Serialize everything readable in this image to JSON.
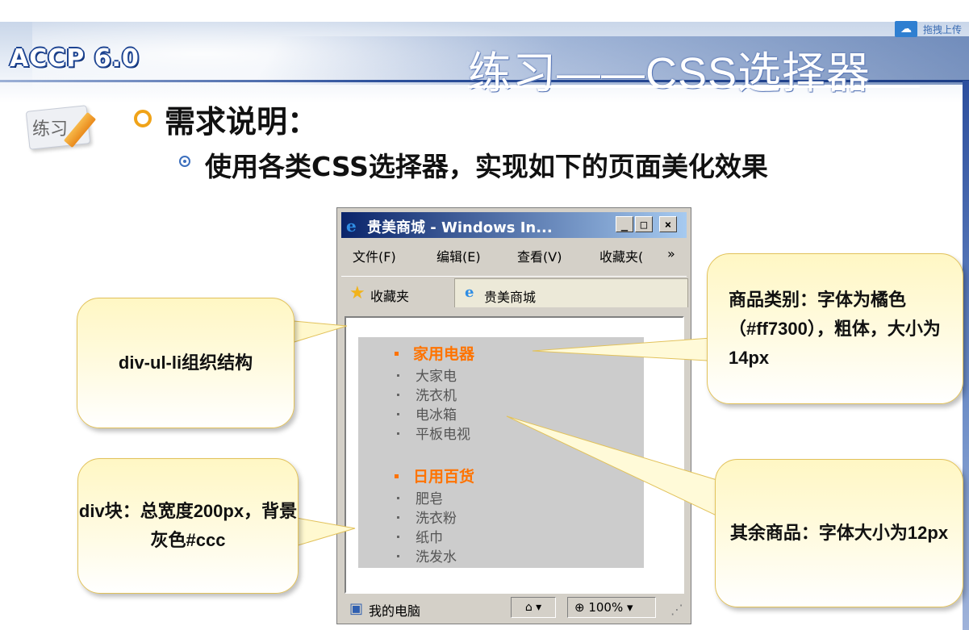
{
  "header": {
    "logo_text": "ACCP 6.0",
    "title": "练习——CSS选择器",
    "upload_label": "拖拽上传",
    "upload_icon": "cloud-upload-icon"
  },
  "practice_badge": {
    "label": "练习",
    "icon": "pencil-icon"
  },
  "requirements": {
    "heading": "需求说明：",
    "bullet_text": "使用各类CSS选择器，实现如下的页面美化效果"
  },
  "browser": {
    "window_title": "贵美商城 - Windows In...",
    "window_buttons": [
      "_",
      "□",
      "×"
    ],
    "menu": [
      "文件(F)",
      "编辑(E)",
      "查看(V)",
      "收藏夹(",
      "»"
    ],
    "favorites_label": "收藏夹",
    "tab_label": "贵美商城",
    "categories": [
      {
        "name": "家用电器",
        "items": [
          "大家电",
          "洗衣机",
          "电冰箱",
          "平板电视"
        ]
      },
      {
        "name": "日用百货",
        "items": [
          "肥皂",
          "洗衣粉",
          "纸巾",
          "洗发水"
        ]
      }
    ],
    "status_label": "我的电脑",
    "zoom": "100%",
    "colors": {
      "category": "#ff7300",
      "block_bg": "#cccccc"
    }
  },
  "callouts": {
    "structure": "div-ul-li组织结构",
    "category_style": "商品类别：字体为橘色（#ff7300），粗体，大小为14px",
    "block_style": "div块：总宽度200px，背景灰色#ccc",
    "item_style": "其余商品：字体大小为12px"
  }
}
